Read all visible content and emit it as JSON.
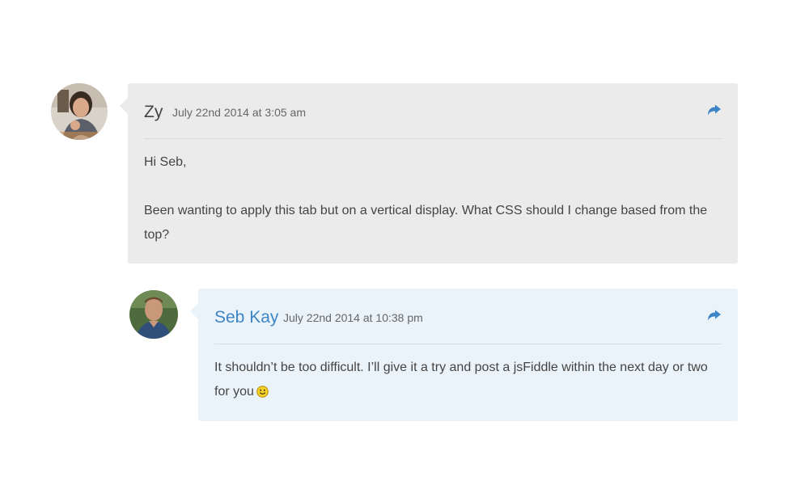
{
  "colors": {
    "comment_bg": "#ebebeb",
    "reply_bg": "#eaf3f9",
    "link_blue": "#3d85c6",
    "author_dark": "#444444",
    "divider": "#dadada"
  },
  "comments": [
    {
      "author": "Zy",
      "date": "July 22nd 2014 at 3:05 am",
      "paragraphs": [
        "Hi Seb,",
        "Been wanting to apply this tab but on a vertical display. What CSS should I change based from the top?"
      ],
      "reply_icon": "reply-arrow-icon",
      "avatar": "user-avatar-photo"
    },
    {
      "author": "Seb Kay",
      "date": "July 22nd 2014 at 10:38 pm",
      "text_line1": "It shouldn’t be too difficult. I’ll give it a try and post a jsFiddle within the next day or two",
      "text_line2": "for you",
      "emoji": "smiley-emoji-icon",
      "reply_icon": "reply-arrow-icon",
      "avatar": "user-avatar-photo"
    }
  ]
}
